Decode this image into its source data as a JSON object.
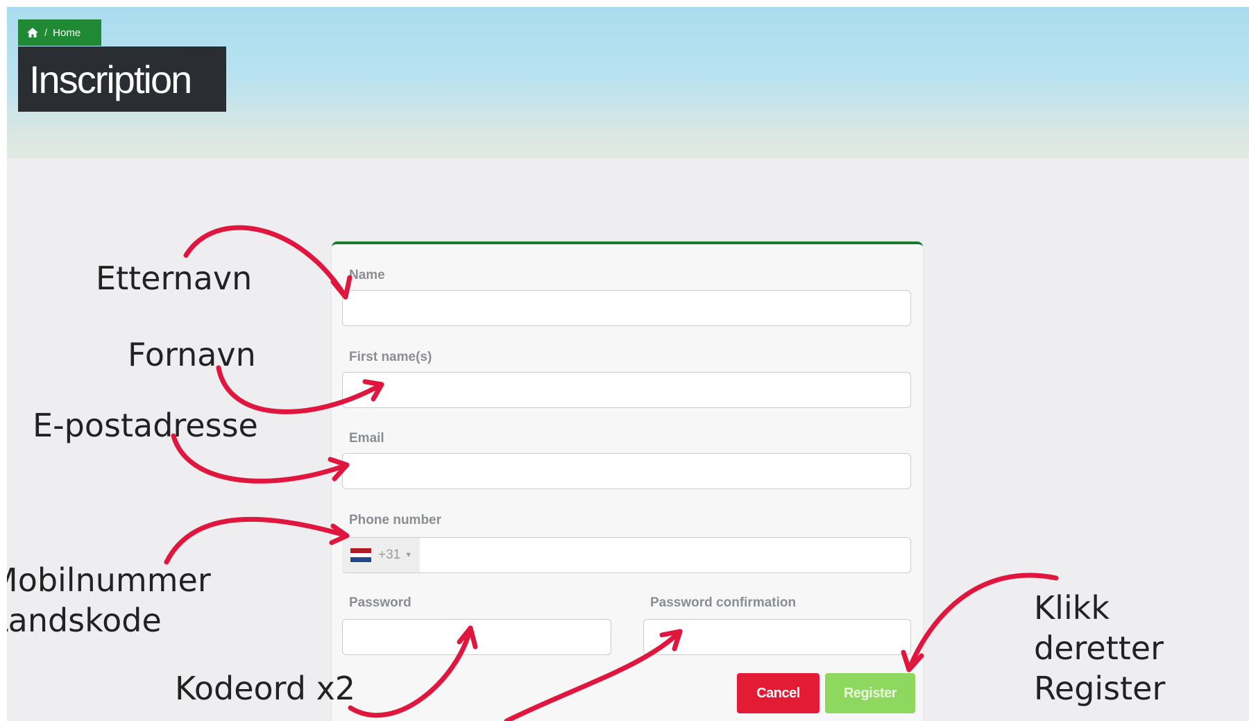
{
  "breadcrumb": {
    "home_label": "Home",
    "separator": "/"
  },
  "page_title": "Inscription",
  "form": {
    "name_label": "Name",
    "first_name_label": "First name(s)",
    "email_label": "Email",
    "phone_label": "Phone number",
    "phone_country_code": "+31",
    "password_label": "Password",
    "password_confirmation_label": "Password confirmation",
    "cancel_label": "Cancel",
    "register_label": "Register"
  },
  "annotations": {
    "etternavn": "Etternavn",
    "fornavn": "Fornavn",
    "epost": "E-postadresse",
    "mobil": "Mobilnummer",
    "landskode": "Landskode",
    "kodeord": "Kodeord x2",
    "klikk_line1": "Klikk",
    "klikk_line2": "deretter",
    "klikk_line3": "Register"
  },
  "colors": {
    "breadcrumb_bg": "#1f8a33",
    "title_bg": "#2a2d32",
    "cancel": "#e31b34",
    "register": "#8fd860",
    "arrow": "#e0163e",
    "card_border": "#1c7a2e"
  },
  "icons": {
    "home": "home-icon",
    "flag": "netherlands-flag-icon",
    "caret": "caret-down-icon"
  }
}
